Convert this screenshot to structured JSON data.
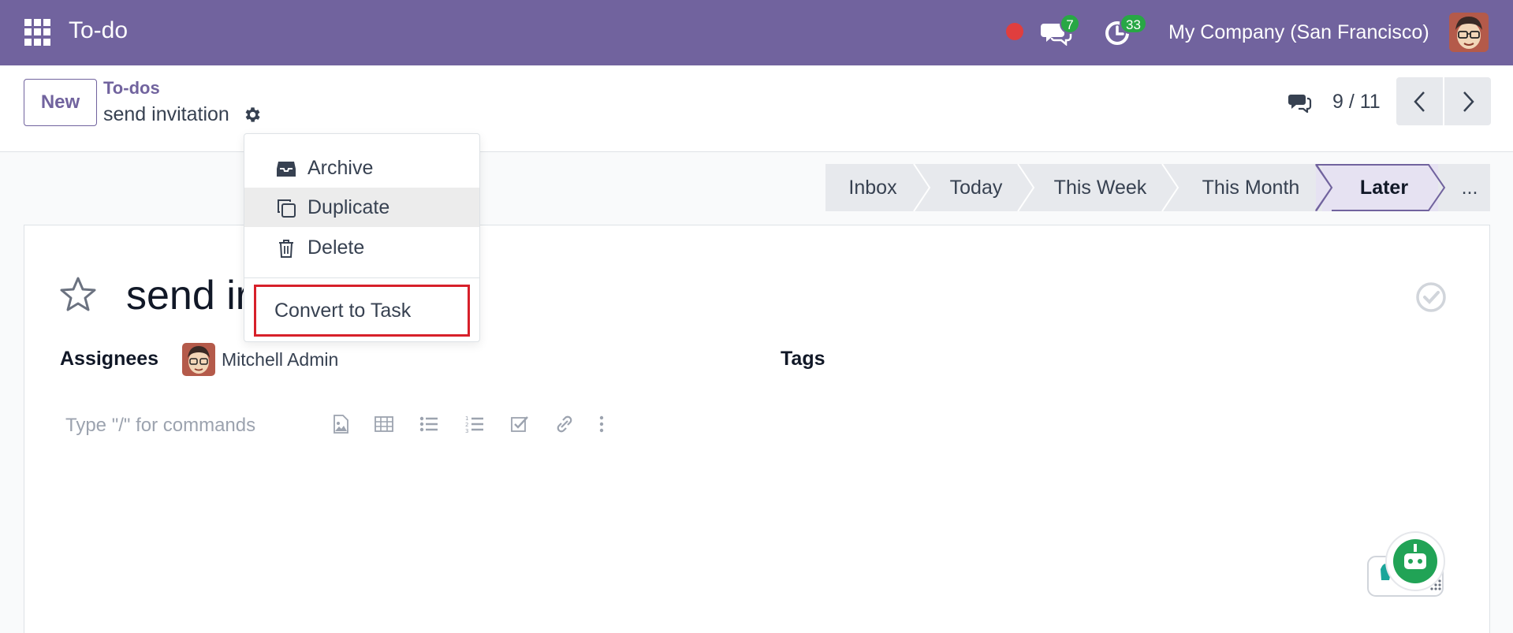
{
  "navbar": {
    "app_title": "To-do",
    "messages_count": "7",
    "activities_count": "33",
    "company": "My Company (San Francisco)",
    "bg_color": "#71639e"
  },
  "control_panel": {
    "new_label": "New",
    "breadcrumb_parent": "To-dos",
    "breadcrumb_current": "send invitation",
    "pager_value": "9 / 11"
  },
  "status_bar": {
    "stages": [
      {
        "label": "Inbox",
        "active": false
      },
      {
        "label": "Today",
        "active": false
      },
      {
        "label": "This Week",
        "active": false
      },
      {
        "label": "This Month",
        "active": false
      },
      {
        "label": "Later",
        "active": true
      },
      {
        "label": "...",
        "active": false
      }
    ]
  },
  "form": {
    "title": "send ir",
    "assignees_label": "Assignees",
    "assignee_name": "Mitchell Admin",
    "tags_label": "Tags",
    "editor_placeholder": "Type \"/\" for commands"
  },
  "dropdown": {
    "items": [
      {
        "label": "Archive",
        "icon": "archive-icon"
      },
      {
        "label": "Duplicate",
        "icon": "duplicate-icon"
      },
      {
        "label": "Delete",
        "icon": "trash-icon"
      }
    ],
    "convert_label": "Convert to Task",
    "highlight_color": "#d7202a"
  }
}
